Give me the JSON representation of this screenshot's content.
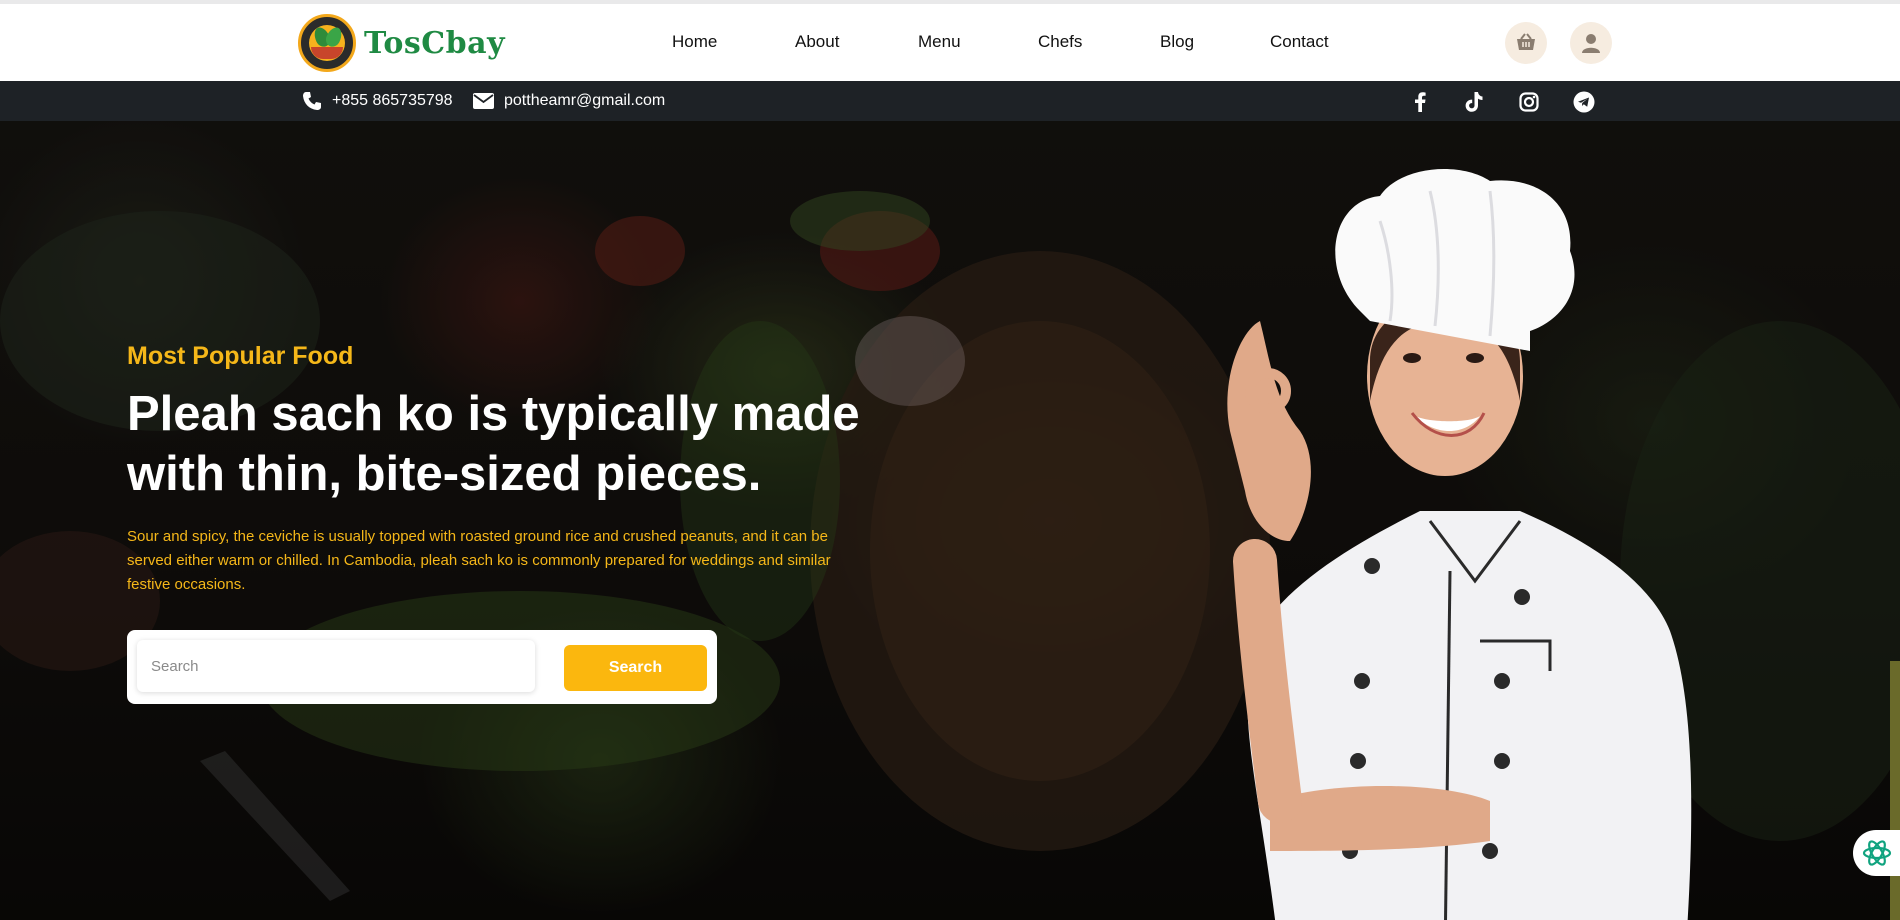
{
  "brand": {
    "name": "TosCbay"
  },
  "nav": {
    "items": [
      {
        "label": "Home"
      },
      {
        "label": "About"
      },
      {
        "label": "Menu"
      },
      {
        "label": "Chefs"
      },
      {
        "label": "Blog"
      },
      {
        "label": "Contact"
      }
    ]
  },
  "header_icons": {
    "cart": "cart-icon",
    "user": "user-icon"
  },
  "infobar": {
    "phone": "+855 865735798",
    "email": "pottheamr@gmail.com",
    "social": [
      "facebook-icon",
      "tiktok-icon",
      "instagram-icon",
      "telegram-icon"
    ]
  },
  "hero": {
    "subtitle": "Most Popular Food",
    "title": "Pleah sach ko is typically made with thin, bite-sized pieces.",
    "description": "Sour and spicy, the ceviche is usually topped with roasted ground rice and crushed peanuts, and it can be served either warm or chilled. In Cambodia, pleah sach ko is commonly prepared for weddings and similar festive occasions.",
    "search_placeholder": "Search",
    "search_button": "Search"
  },
  "colors": {
    "accent": "#fbb70e",
    "brand_green": "#1f8a43",
    "infobar_bg": "#1e2226"
  }
}
